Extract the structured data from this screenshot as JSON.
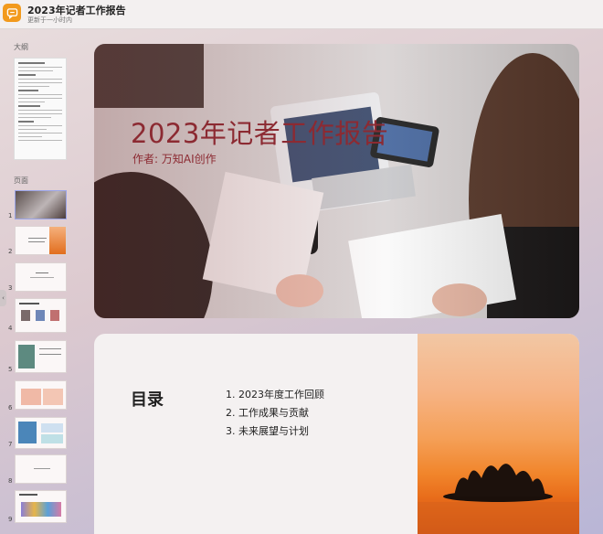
{
  "app": {
    "title": "2023年记者工作报告",
    "subtitle": "更新于一小时内",
    "icon": "chat-bubble-icon",
    "accent": "#f29a1d"
  },
  "sidebar": {
    "outline_label": "大纲",
    "pages_label": "页面",
    "pages": [
      {
        "number": "1"
      },
      {
        "number": "2"
      },
      {
        "number": "3"
      },
      {
        "number": "4"
      },
      {
        "number": "5"
      },
      {
        "number": "6"
      },
      {
        "number": "7"
      },
      {
        "number": "8"
      },
      {
        "number": "9"
      }
    ],
    "selected_page": 1
  },
  "slides": {
    "cover": {
      "title": "2023年记者工作报告",
      "author": "作者: 万知AI创作",
      "title_color": "#8c2a32"
    },
    "toc": {
      "title": "目录",
      "items": [
        "1. 2023年度工作回顾",
        "2. 工作成果与贡献",
        "3. 未来展望与计划"
      ]
    }
  }
}
